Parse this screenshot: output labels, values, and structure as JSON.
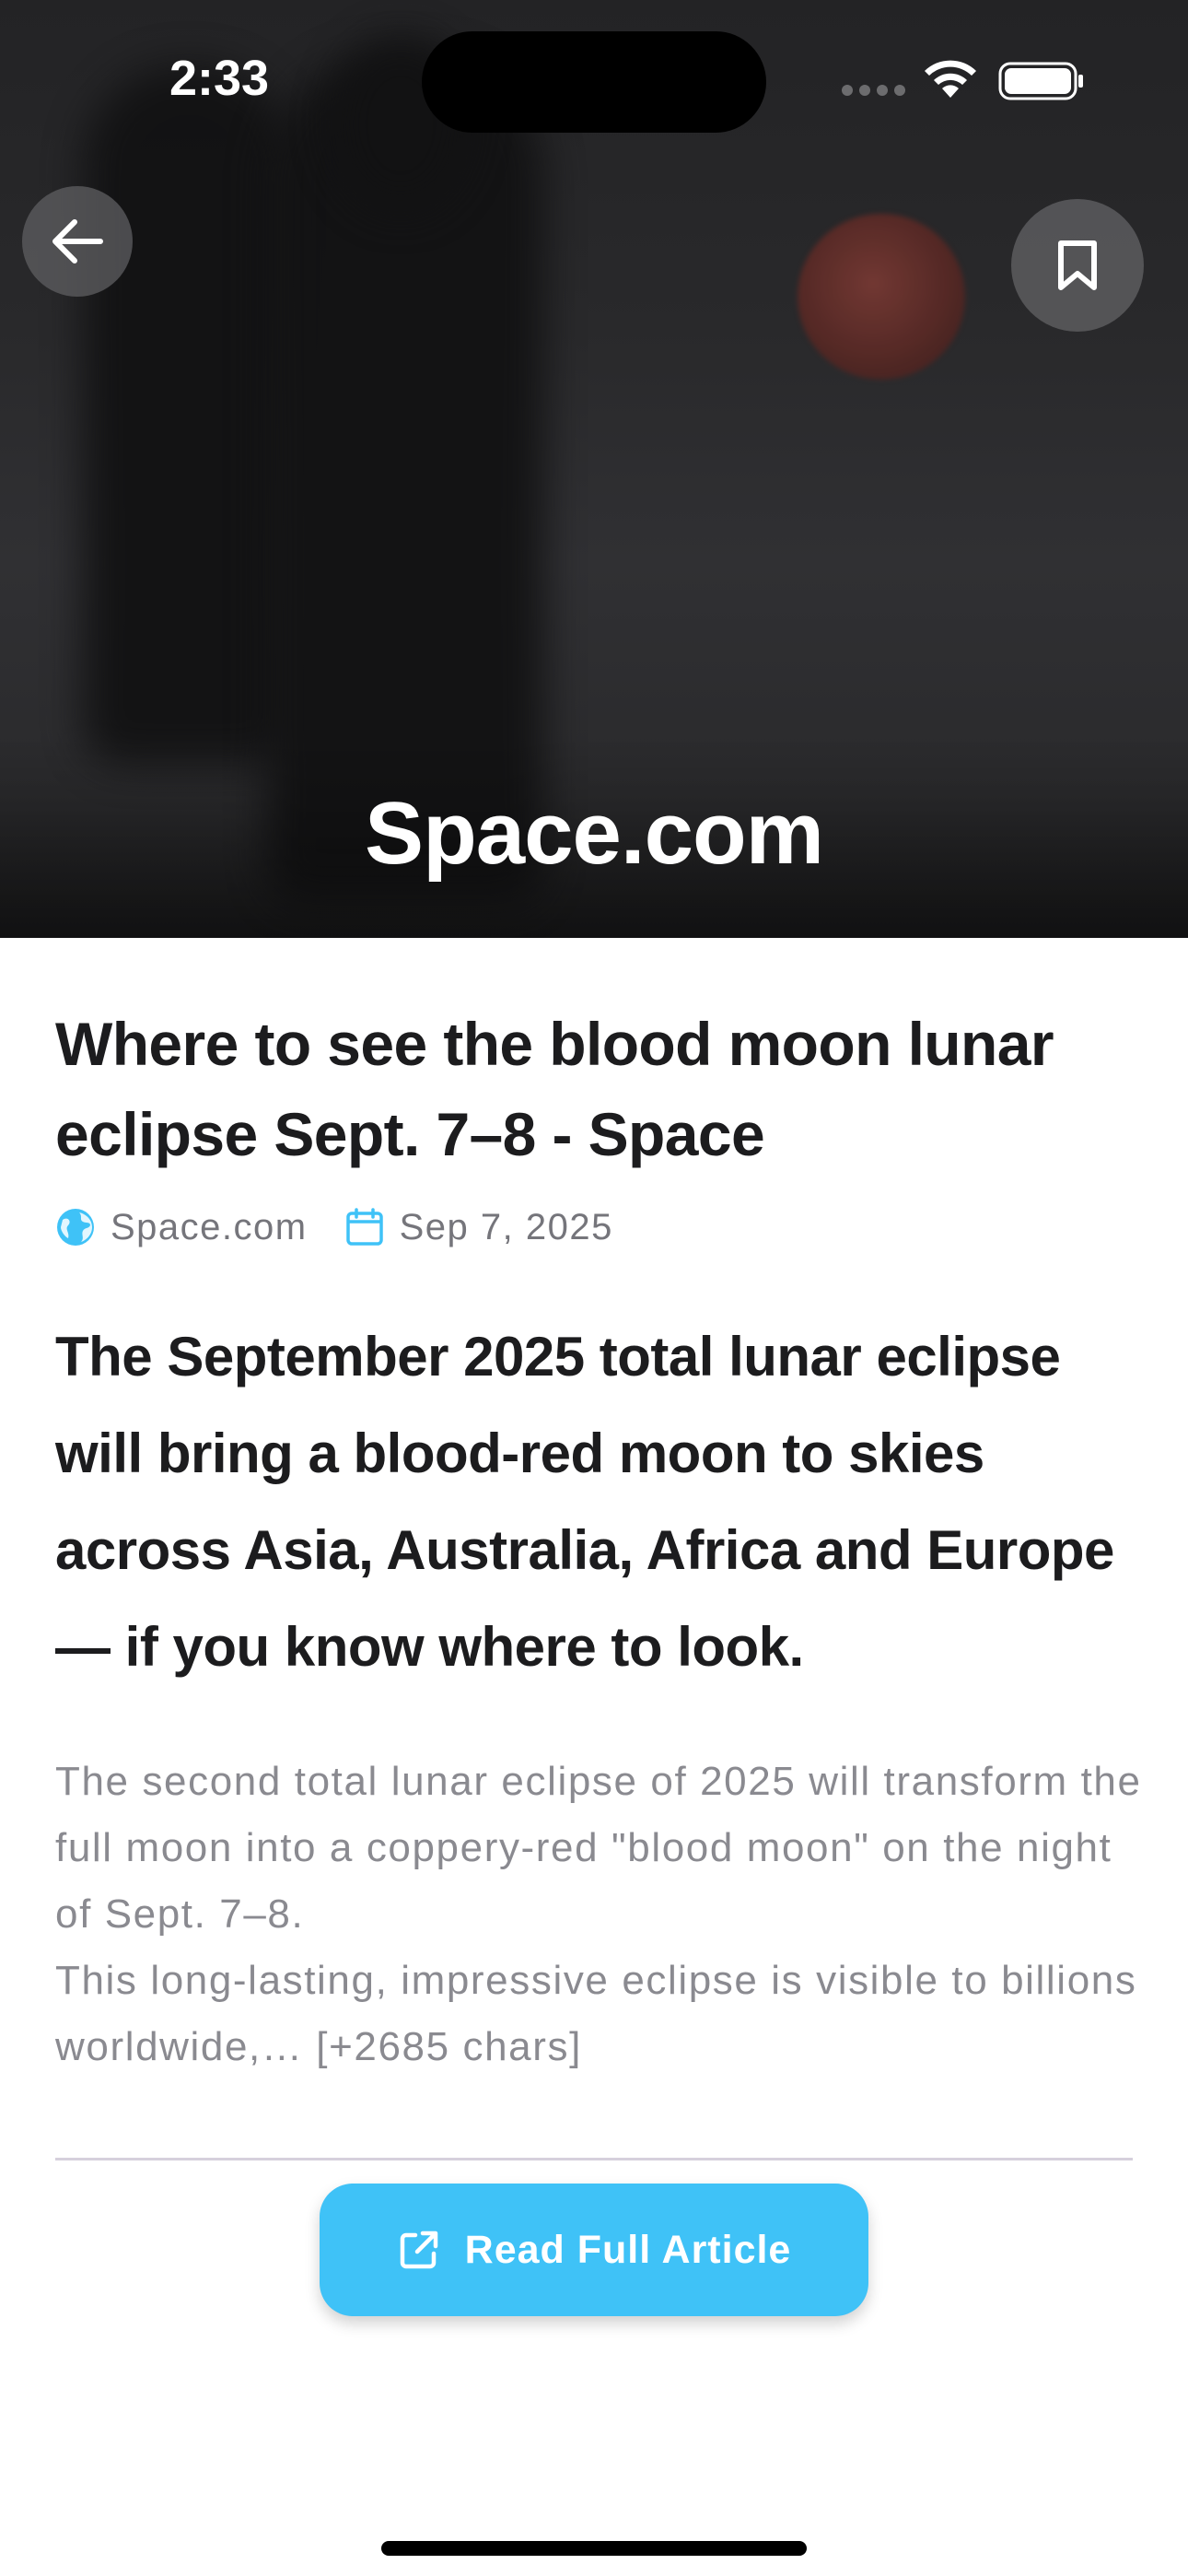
{
  "status_bar": {
    "time": "2:33"
  },
  "hero": {
    "source_title": "Space.com"
  },
  "icons": {
    "back": "arrow-left-icon",
    "bookmark": "bookmark-icon",
    "source": "globe-icon",
    "date": "calendar-icon",
    "open_external": "external-link-icon",
    "wifi": "wifi-icon",
    "battery": "battery-icon"
  },
  "article": {
    "title": "Where to see the blood moon lunar eclipse Sept. 7–8 - Space",
    "source": "Space.com",
    "date": "Sep 7, 2025",
    "lead": "The September 2025 total lunar eclipse will bring a blood-red moon to skies across Asia, Australia, Africa and Europe — if you know where to look.",
    "body": "The second total lunar eclipse of 2025 will transform the full moon into a coppery-red \"blood moon\" on the night of Sept. 7–8.\nThis long-lasting, impressive eclipse is visible to billions worldwide,… [+2685 chars]"
  },
  "actions": {
    "read_full_article": "Read Full Article"
  },
  "colors": {
    "accent": "#3fc2f7",
    "title_text": "#1c1c1e",
    "meta_text": "#75757b",
    "body_text": "#8a8a90",
    "divider": "#d6d0dc"
  }
}
